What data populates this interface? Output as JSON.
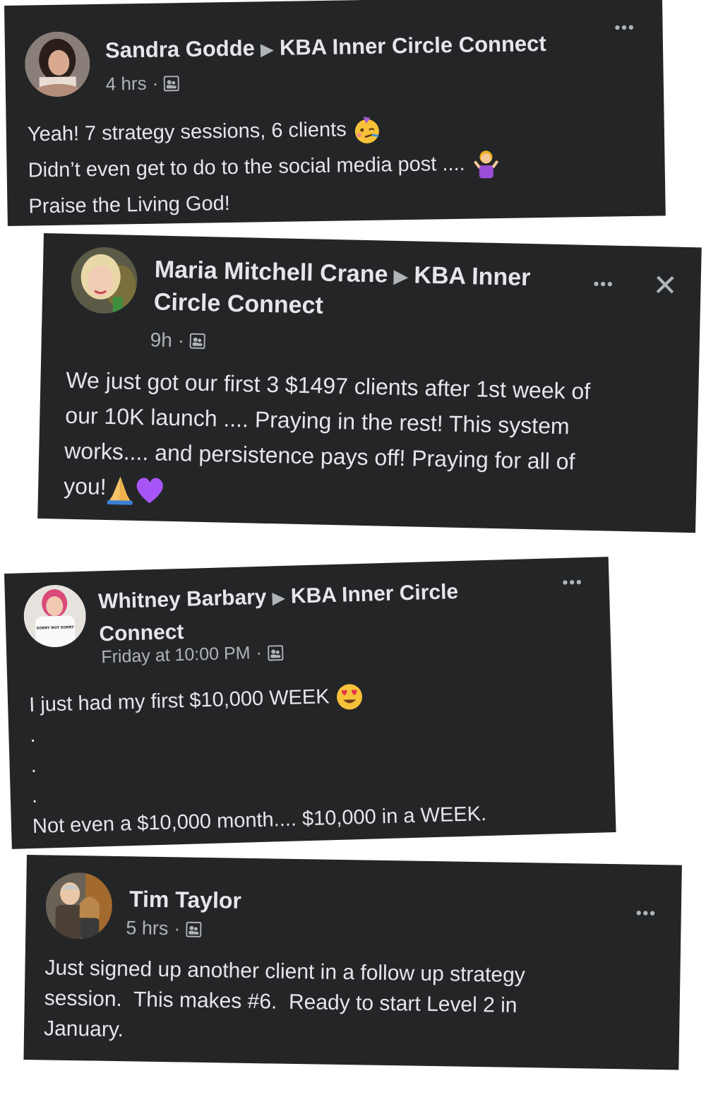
{
  "posts": [
    {
      "author": "Sandra Godde",
      "group": "KBA Inner Circle Connect",
      "time": "4 hrs",
      "separator": "·",
      "icons": {
        "avatar": "avatar-photo",
        "privacy": "group-members-icon",
        "more": "more-options-icon"
      },
      "more_label": "•••",
      "lines": [
        "Yeah! 7 strategy sessions, 6 clients",
        "Didn’t even get to do to the social media post ....",
        "Praise the Living God!"
      ]
    },
    {
      "author": "Maria Mitchell Crane",
      "group_part1": "KBA Inner",
      "group_part2": "Circle Connect",
      "time": "9h",
      "separator": "·",
      "icons": {
        "avatar": "avatar-photo",
        "privacy": "group-members-icon",
        "more": "more-options-icon",
        "close": "close-icon"
      },
      "more_label": "•••",
      "close_label": "✕",
      "lines": [
        "We just got our first 3 $1497 clients after 1st week of",
        "our 10K launch .... Praying in the rest! This system",
        "works.... and persistence pays off! Praying for all of",
        "you!"
      ]
    },
    {
      "author": "Whitney Barbary",
      "group_part1": "KBA Inner Circle",
      "group_part2": "Connect",
      "time": "Friday at 10:00 PM",
      "separator": "·",
      "icons": {
        "avatar": "avatar-photo",
        "privacy": "group-members-icon",
        "more": "more-options-icon"
      },
      "more_label": "•••",
      "shirt_text": "SORRY NOT SORRY",
      "lines": [
        "I just had my first $10,000 WEEK",
        ".",
        ".",
        ".",
        "Not even a $10,000 month.... $10,000 in a WEEK."
      ]
    },
    {
      "author": "Tim Taylor",
      "time": "5 hrs",
      "separator": "·",
      "icons": {
        "avatar": "avatar-photo",
        "privacy": "group-members-icon",
        "more": "more-options-icon"
      },
      "more_label": "•••",
      "lines": [
        "Just signed up another client in a follow up strategy",
        "session.  This makes #6.  Ready to start Level 2 in",
        "January."
      ]
    }
  ],
  "emojis": {
    "party": "partying-face-emoji",
    "shrug": "person-shrugging-emoji",
    "pray": "folded-hands-emoji",
    "heart": "purple-heart-emoji",
    "hearteyes": "heart-eyes-emoji"
  },
  "colors": {
    "card_bg": "#242526",
    "primary_text": "#e4e6eb",
    "secondary_text": "#b0b3b8"
  }
}
